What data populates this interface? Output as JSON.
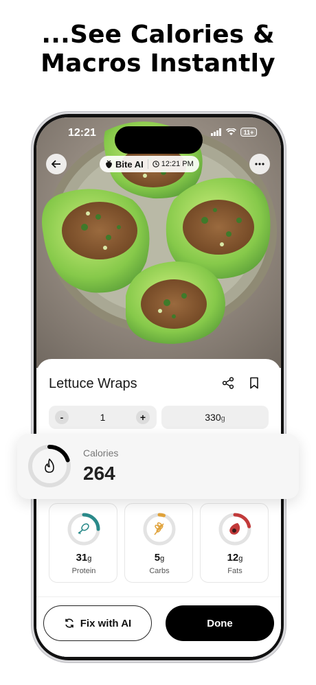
{
  "headline": {
    "line1": "...See Calories &",
    "line2": "Macros Instantly"
  },
  "status_bar": {
    "time": "12:21",
    "battery": "11+"
  },
  "photo_overlay": {
    "brand": "Bite AI",
    "timestamp": "12:21 PM"
  },
  "food": {
    "name": "Lettuce Wraps",
    "quantity": "1",
    "weight": "330",
    "weight_unit": "g"
  },
  "calories": {
    "label": "Calories",
    "value": "264",
    "progress": 0.2,
    "color": "#000000"
  },
  "macros": [
    {
      "label": "Protein",
      "value": "31",
      "unit": "g",
      "progress": 0.25,
      "color": "#2a8a8a"
    },
    {
      "label": "Carbs",
      "value": "5",
      "unit": "g",
      "progress": 0.05,
      "color": "#e0a23a"
    },
    {
      "label": "Fats",
      "value": "12",
      "unit": "g",
      "progress": 0.22,
      "color": "#c23a3a"
    }
  ],
  "actions": {
    "fix": "Fix with AI",
    "done": "Done"
  },
  "icons": [
    "back-arrow-icon",
    "more-icon",
    "share-icon",
    "bookmark-icon",
    "flame-icon",
    "drumstick-icon",
    "wheat-icon",
    "avocado-icon",
    "refresh-icon",
    "clock-icon",
    "strawberry-icon"
  ]
}
